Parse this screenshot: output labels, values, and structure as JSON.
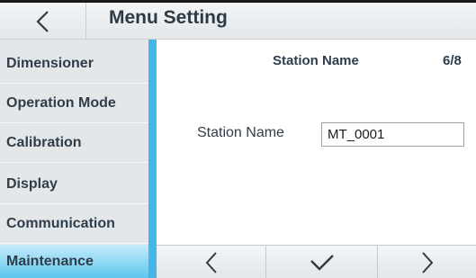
{
  "header": {
    "title": "Menu Setting",
    "back_icon": "chevron-left-icon"
  },
  "sidebar": {
    "items": [
      {
        "label": "Dimensioner",
        "active": false
      },
      {
        "label": "Operation Mode",
        "active": false
      },
      {
        "label": "Calibration",
        "active": false
      },
      {
        "label": "Display",
        "active": false
      },
      {
        "label": "Communication",
        "active": false
      },
      {
        "label": "Maintenance",
        "active": true
      }
    ]
  },
  "main": {
    "page_title": "Station Name",
    "page_indicator": "6/8",
    "field": {
      "label": "Station Name",
      "value": "MT_0001"
    }
  },
  "nav": {
    "prev_icon": "chevron-left-icon",
    "confirm_icon": "checkmark-icon",
    "next_icon": "chevron-right-icon"
  },
  "colors": {
    "accent": "#46b6e8",
    "active_item": "#5ec6ee",
    "text": "#2f3d4a"
  }
}
